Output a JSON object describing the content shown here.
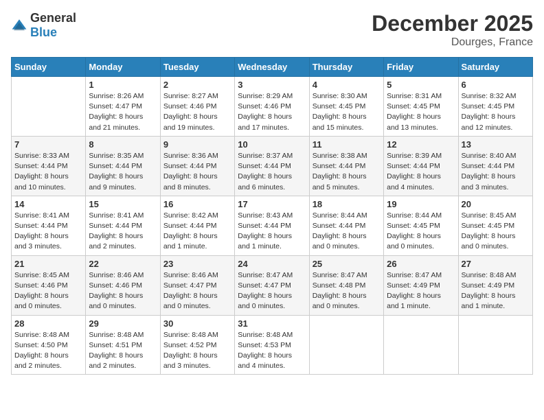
{
  "header": {
    "logo_general": "General",
    "logo_blue": "Blue",
    "month_title": "December 2025",
    "location": "Dourges, France"
  },
  "days_of_week": [
    "Sunday",
    "Monday",
    "Tuesday",
    "Wednesday",
    "Thursday",
    "Friday",
    "Saturday"
  ],
  "weeks": [
    [
      {
        "day": "",
        "info": ""
      },
      {
        "day": "1",
        "info": "Sunrise: 8:26 AM\nSunset: 4:47 PM\nDaylight: 8 hours\nand 21 minutes."
      },
      {
        "day": "2",
        "info": "Sunrise: 8:27 AM\nSunset: 4:46 PM\nDaylight: 8 hours\nand 19 minutes."
      },
      {
        "day": "3",
        "info": "Sunrise: 8:29 AM\nSunset: 4:46 PM\nDaylight: 8 hours\nand 17 minutes."
      },
      {
        "day": "4",
        "info": "Sunrise: 8:30 AM\nSunset: 4:45 PM\nDaylight: 8 hours\nand 15 minutes."
      },
      {
        "day": "5",
        "info": "Sunrise: 8:31 AM\nSunset: 4:45 PM\nDaylight: 8 hours\nand 13 minutes."
      },
      {
        "day": "6",
        "info": "Sunrise: 8:32 AM\nSunset: 4:45 PM\nDaylight: 8 hours\nand 12 minutes."
      }
    ],
    [
      {
        "day": "7",
        "info": "Sunrise: 8:33 AM\nSunset: 4:44 PM\nDaylight: 8 hours\nand 10 minutes."
      },
      {
        "day": "8",
        "info": "Sunrise: 8:35 AM\nSunset: 4:44 PM\nDaylight: 8 hours\nand 9 minutes."
      },
      {
        "day": "9",
        "info": "Sunrise: 8:36 AM\nSunset: 4:44 PM\nDaylight: 8 hours\nand 8 minutes."
      },
      {
        "day": "10",
        "info": "Sunrise: 8:37 AM\nSunset: 4:44 PM\nDaylight: 8 hours\nand 6 minutes."
      },
      {
        "day": "11",
        "info": "Sunrise: 8:38 AM\nSunset: 4:44 PM\nDaylight: 8 hours\nand 5 minutes."
      },
      {
        "day": "12",
        "info": "Sunrise: 8:39 AM\nSunset: 4:44 PM\nDaylight: 8 hours\nand 4 minutes."
      },
      {
        "day": "13",
        "info": "Sunrise: 8:40 AM\nSunset: 4:44 PM\nDaylight: 8 hours\nand 3 minutes."
      }
    ],
    [
      {
        "day": "14",
        "info": "Sunrise: 8:41 AM\nSunset: 4:44 PM\nDaylight: 8 hours\nand 3 minutes."
      },
      {
        "day": "15",
        "info": "Sunrise: 8:41 AM\nSunset: 4:44 PM\nDaylight: 8 hours\nand 2 minutes."
      },
      {
        "day": "16",
        "info": "Sunrise: 8:42 AM\nSunset: 4:44 PM\nDaylight: 8 hours\nand 1 minute."
      },
      {
        "day": "17",
        "info": "Sunrise: 8:43 AM\nSunset: 4:44 PM\nDaylight: 8 hours\nand 1 minute."
      },
      {
        "day": "18",
        "info": "Sunrise: 8:44 AM\nSunset: 4:44 PM\nDaylight: 8 hours\nand 0 minutes."
      },
      {
        "day": "19",
        "info": "Sunrise: 8:44 AM\nSunset: 4:45 PM\nDaylight: 8 hours\nand 0 minutes."
      },
      {
        "day": "20",
        "info": "Sunrise: 8:45 AM\nSunset: 4:45 PM\nDaylight: 8 hours\nand 0 minutes."
      }
    ],
    [
      {
        "day": "21",
        "info": "Sunrise: 8:45 AM\nSunset: 4:46 PM\nDaylight: 8 hours\nand 0 minutes."
      },
      {
        "day": "22",
        "info": "Sunrise: 8:46 AM\nSunset: 4:46 PM\nDaylight: 8 hours\nand 0 minutes."
      },
      {
        "day": "23",
        "info": "Sunrise: 8:46 AM\nSunset: 4:47 PM\nDaylight: 8 hours\nand 0 minutes."
      },
      {
        "day": "24",
        "info": "Sunrise: 8:47 AM\nSunset: 4:47 PM\nDaylight: 8 hours\nand 0 minutes."
      },
      {
        "day": "25",
        "info": "Sunrise: 8:47 AM\nSunset: 4:48 PM\nDaylight: 8 hours\nand 0 minutes."
      },
      {
        "day": "26",
        "info": "Sunrise: 8:47 AM\nSunset: 4:49 PM\nDaylight: 8 hours\nand 1 minute."
      },
      {
        "day": "27",
        "info": "Sunrise: 8:48 AM\nSunset: 4:49 PM\nDaylight: 8 hours\nand 1 minute."
      }
    ],
    [
      {
        "day": "28",
        "info": "Sunrise: 8:48 AM\nSunset: 4:50 PM\nDaylight: 8 hours\nand 2 minutes."
      },
      {
        "day": "29",
        "info": "Sunrise: 8:48 AM\nSunset: 4:51 PM\nDaylight: 8 hours\nand 2 minutes."
      },
      {
        "day": "30",
        "info": "Sunrise: 8:48 AM\nSunset: 4:52 PM\nDaylight: 8 hours\nand 3 minutes."
      },
      {
        "day": "31",
        "info": "Sunrise: 8:48 AM\nSunset: 4:53 PM\nDaylight: 8 hours\nand 4 minutes."
      },
      {
        "day": "",
        "info": ""
      },
      {
        "day": "",
        "info": ""
      },
      {
        "day": "",
        "info": ""
      }
    ]
  ]
}
